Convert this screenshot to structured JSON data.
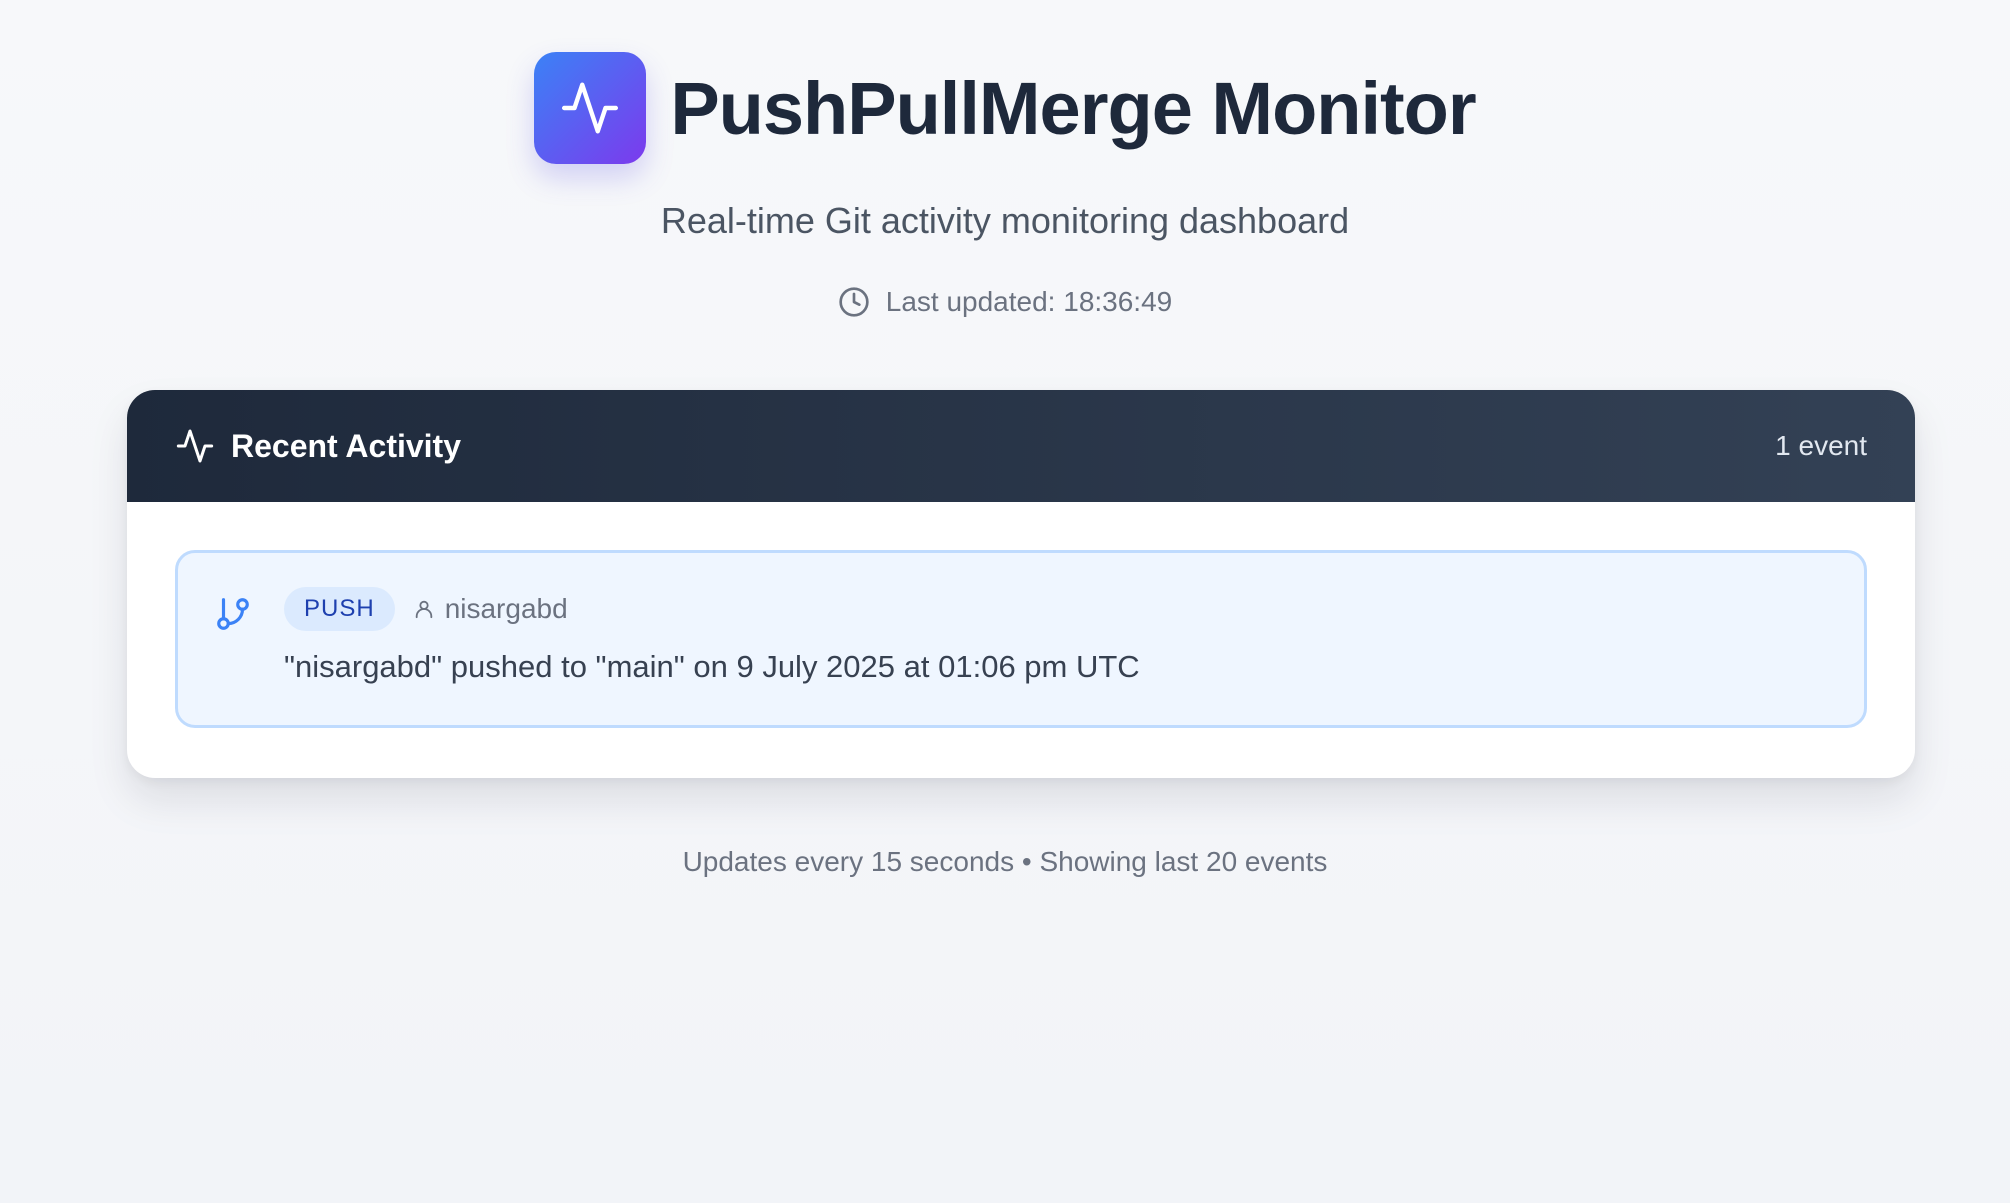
{
  "app": {
    "title": "PushPullMerge Monitor",
    "subtitle": "Real-time Git activity monitoring dashboard",
    "last_updated": "Last updated: 18:36:49",
    "logo_icon": "activity-pulse-icon",
    "accent_gradient": [
      "#3b82f6",
      "#7c3aed"
    ]
  },
  "activity": {
    "heading": "Recent Activity",
    "count_label": "1 event",
    "header_color": "#1e293b",
    "events": [
      {
        "type": "PUSH",
        "author": "nisargabd",
        "message": "\"nisargabd\" pushed to \"main\" on 9 July 2025 at 01:06 pm UTC",
        "icon": "git-branch-icon",
        "badge_bg": "#dbeafe",
        "badge_color": "#1e40af"
      }
    ]
  },
  "footer": {
    "text": "Updates every 15 seconds • Showing last 20 events"
  }
}
